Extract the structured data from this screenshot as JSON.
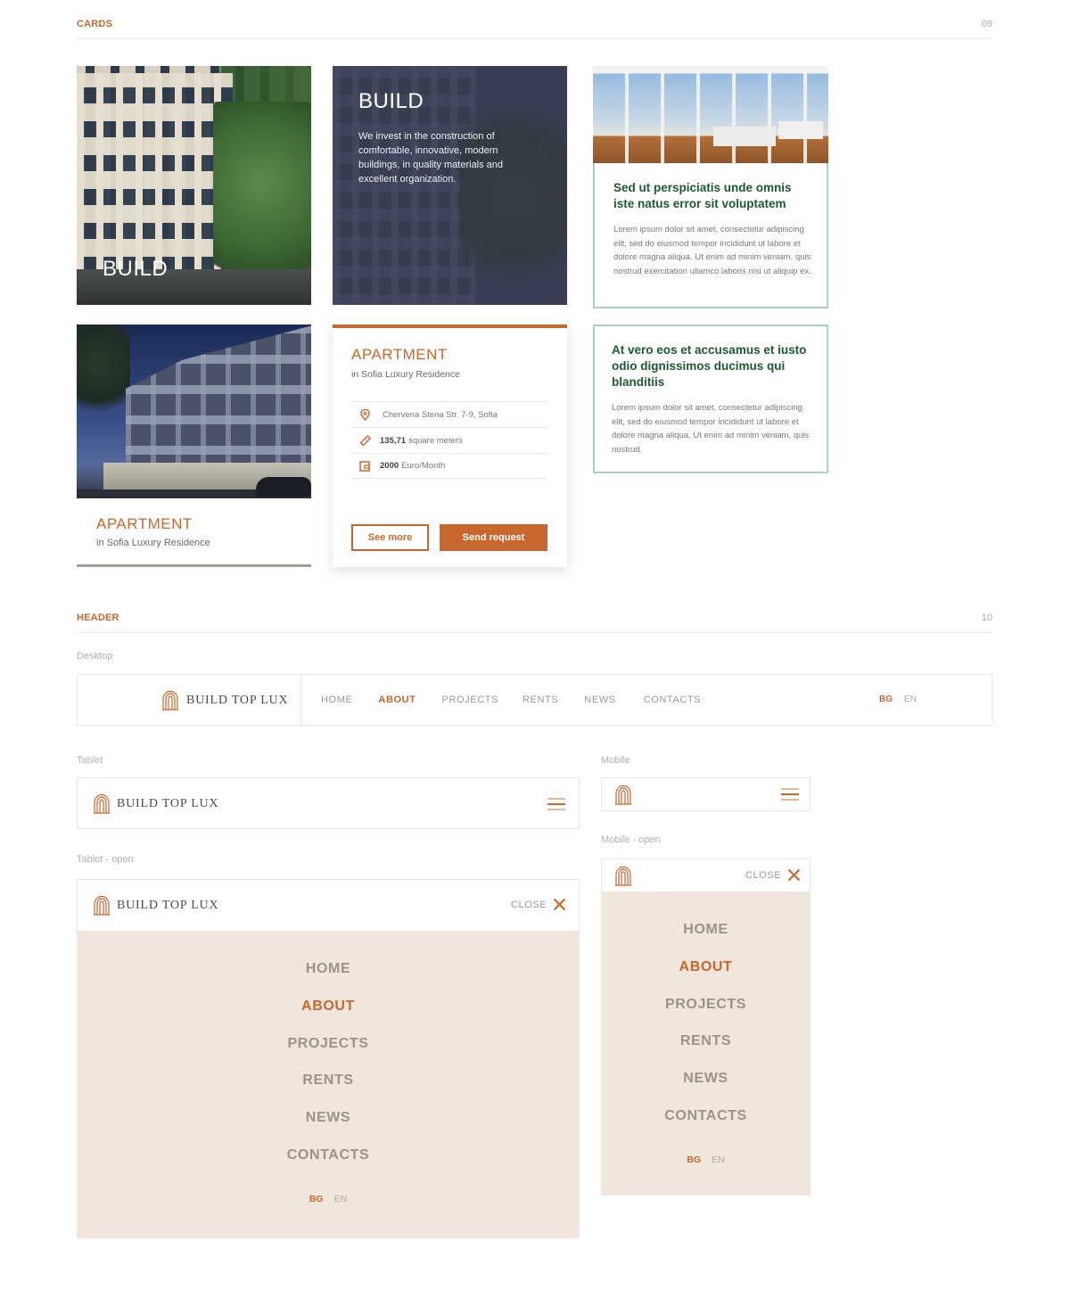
{
  "sections": {
    "cards": {
      "title": "CARDS",
      "number": "09"
    },
    "header": {
      "title": "HEADER",
      "number": "10"
    }
  },
  "cards": {
    "image_build": {
      "overlay_title": "BUILD"
    },
    "dark_build": {
      "title": "BUILD",
      "text": "We invest in the construction of comfortable, innovative, modern buildings, in quality materials and excellent organization."
    },
    "green_card_1": {
      "title": "Sed ut perspiciatis unde omnis iste natus error sit voluptatem",
      "text": "Lorem ipsum dolor sit amet, consectetur adipiscing elit, sed do eiusmod tempor incididunt ut labore et dolore magna aliqua. Ut enim ad minim veniam, quis nostrud exercitation ullamco laboris nisi ut aliquip ex."
    },
    "green_card_2": {
      "title": "At vero eos et accusamus et iusto odio dignissimos ducimus qui blanditiis",
      "text": "Lorem ipsum dolor sit amet, consectetur adipiscing elit, sed do eiusmod tempor incididunt ut labore et dolore magna aliqua. Ut enim ad minim veniam, quis nostrud."
    },
    "apartment_image_card": {
      "title": "APARTMENT",
      "subtitle": "in Sofia Luxury Residence"
    },
    "apartment_detail_card": {
      "title": "APARTMENT",
      "subtitle": "in Sofia Luxury Residence",
      "rows": [
        {
          "icon": "location-pin-icon",
          "bold": "",
          "text": "Chervena Stena Str. 7-9, Sofia"
        },
        {
          "icon": "ruler-icon",
          "bold": "135,71",
          "text": "square meters"
        },
        {
          "icon": "wallet-icon",
          "bold": "2000",
          "text": "Euro/Month"
        }
      ],
      "see_more_label": "See more",
      "send_request_label": "Send request"
    }
  },
  "header_variants": {
    "labels": {
      "desktop": "Desktop",
      "tablet": "Tablet",
      "mobile": "Mobile",
      "tablet_open": "Tablet - open",
      "mobile_open": "Mobile - open"
    },
    "brand": "BUILD TOP LUX",
    "nav": [
      {
        "label": "HOME",
        "active": false
      },
      {
        "label": "ABOUT",
        "active": true
      },
      {
        "label": "PROJECTS",
        "active": false
      },
      {
        "label": "RENTS",
        "active": false
      },
      {
        "label": "NEWS",
        "active": false
      },
      {
        "label": "CONTACTS",
        "active": false
      }
    ],
    "languages": [
      {
        "label": "BG",
        "active": true
      },
      {
        "label": "EN",
        "active": false
      }
    ],
    "close_label": "CLOSE"
  },
  "colors": {
    "accent": "#c8672e",
    "green_title": "#1d5a2f",
    "green_border": "#a8d4bd",
    "menu_bg": "#f1e6dc"
  }
}
